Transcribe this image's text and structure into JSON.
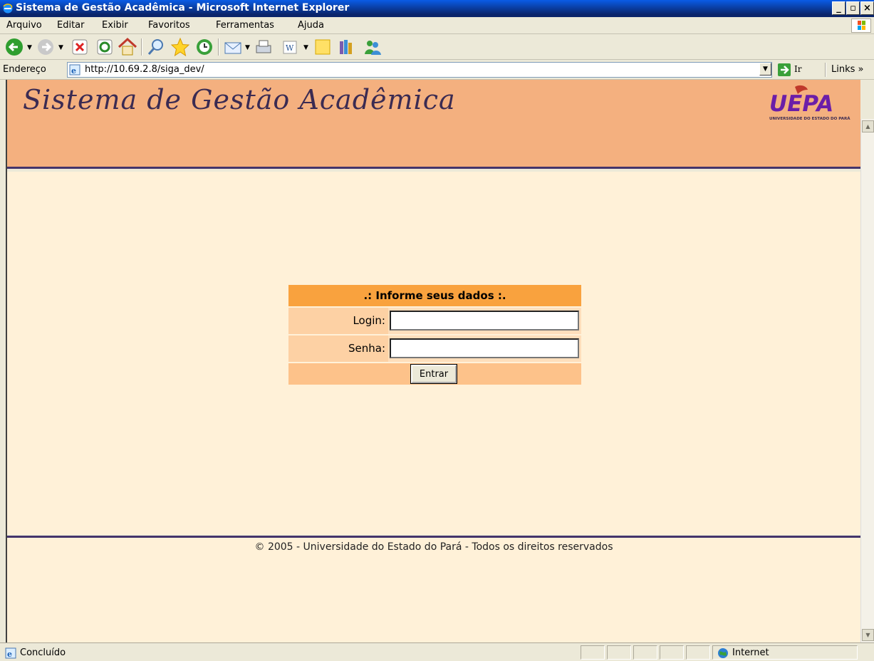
{
  "window": {
    "title": "Sistema de Gestão Acadêmica - Microsoft Internet Explorer",
    "minimize_glyph": "_",
    "maximize_glyph": "▫",
    "close_glyph": "×"
  },
  "menu": {
    "items": [
      "Arquivo",
      "Editar",
      "Exibir",
      "Favoritos",
      "Ferramentas",
      "Ajuda"
    ]
  },
  "toolbar": {
    "icons": [
      "back-icon",
      "forward-icon",
      "stop-icon",
      "refresh-icon",
      "home-icon",
      "search-icon",
      "favorites-icon",
      "history-icon",
      "mail-icon",
      "print-icon",
      "word-icon",
      "notes-icon",
      "research-icon",
      "messenger-icon"
    ]
  },
  "address": {
    "label": "Endereço",
    "url": "http://10.69.2.8/siga_dev/",
    "go_label": "Ir",
    "links_label": "Links »"
  },
  "page": {
    "site_title": "Sistema de Gestão Acadêmica",
    "logo_text": "UEPA",
    "logo_subtext": "UNIVERSIDADE DO ESTADO DO PARÁ",
    "login": {
      "header": ".: Informe seus dados :.",
      "login_label": "Login:",
      "password_label": "Senha:",
      "submit_label": "Entrar",
      "login_value": "",
      "password_value": ""
    },
    "footer": "© 2005 - Universidade do Estado do Pará - Todos os direitos reservados"
  },
  "status": {
    "text": "Concluído",
    "zone": "Internet"
  },
  "colors": {
    "header_band": "#f4b07f",
    "page_background": "#fff1d8",
    "login_header": "#f9a23e",
    "divider": "#44356b",
    "title_blue": "#0a246a"
  }
}
